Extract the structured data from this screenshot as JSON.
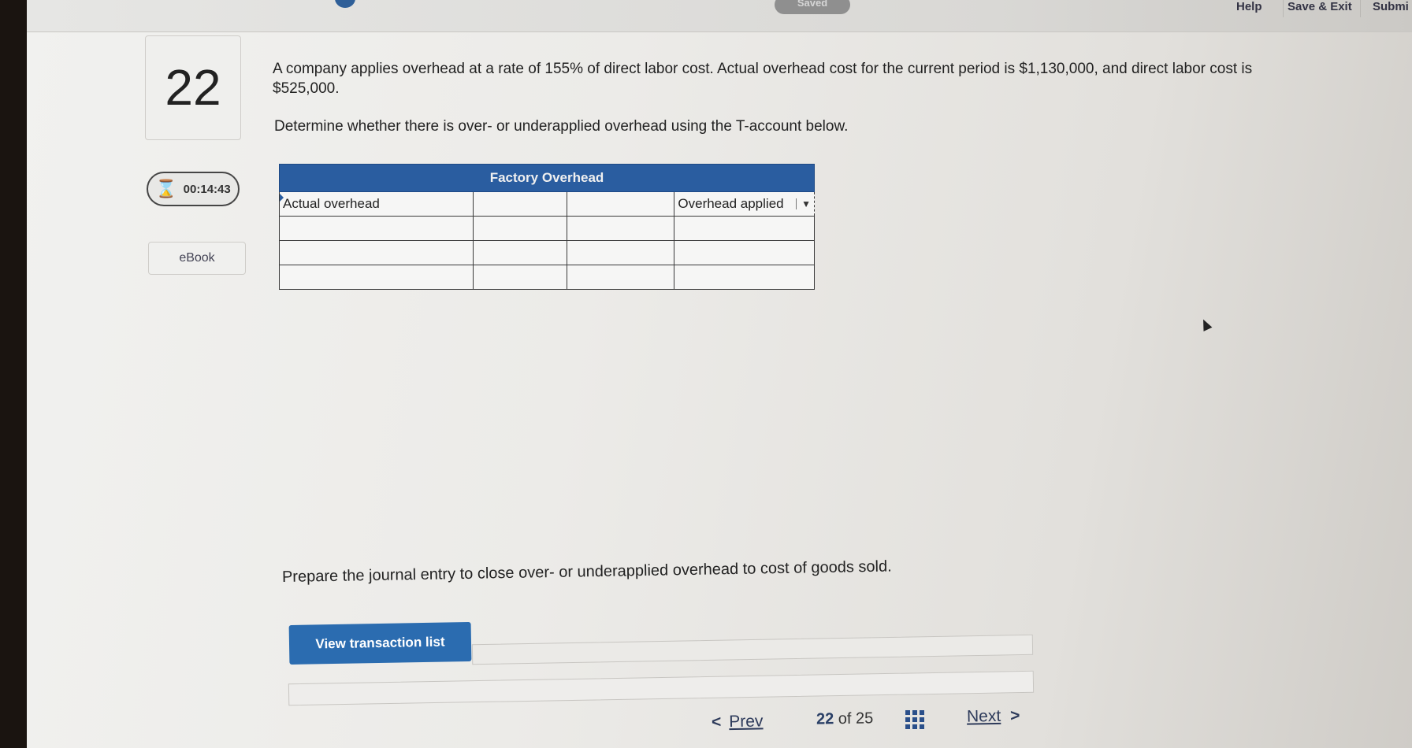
{
  "topbar": {
    "saved_label": "Saved",
    "help_label": "Help",
    "save_exit_label": "Save & Exit",
    "submit_label": "Submi"
  },
  "question": {
    "number": "22",
    "timer": "00:14:43",
    "ebook_label": "eBook",
    "text": "A company applies overhead at a rate of 155% of direct labor cost. Actual overhead cost for the current period is $1,130,000, and direct labor cost is $525,000.",
    "instruction": "Determine whether there is over- or underapplied overhead using the T-account below."
  },
  "taccount": {
    "title": "Factory Overhead",
    "rows": [
      {
        "debit_label": "Actual overhead",
        "debit_amount": "",
        "credit_amount": "",
        "credit_label": "Overhead applied"
      },
      {
        "debit_label": "",
        "debit_amount": "",
        "credit_amount": "",
        "credit_label": ""
      },
      {
        "debit_label": "",
        "debit_amount": "",
        "credit_amount": "",
        "credit_label": ""
      },
      {
        "debit_label": "",
        "debit_amount": "",
        "credit_amount": "",
        "credit_label": ""
      }
    ]
  },
  "journal": {
    "instruction": "Prepare the journal entry to close over- or underapplied overhead to cost of goods sold.",
    "button_label": "View transaction list"
  },
  "footer": {
    "prev_label": "Prev",
    "current_page": "22",
    "of_label": "of",
    "total_pages": "25",
    "next_label": "Next"
  },
  "colors": {
    "header_blue": "#2a5da0",
    "button_blue": "#2b6cb0"
  }
}
